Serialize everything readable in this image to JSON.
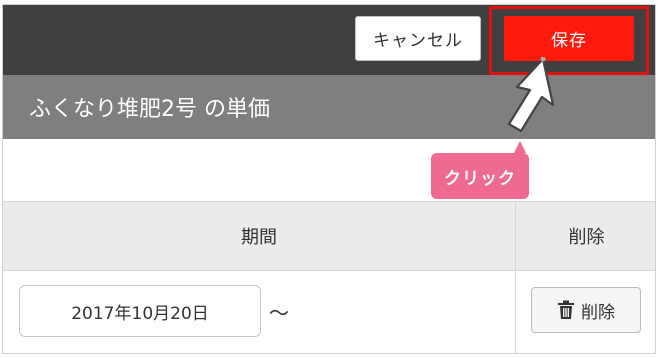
{
  "toolbar": {
    "cancel_label": "キャンセル",
    "save_label": "保存"
  },
  "header": {
    "title": "ふくなり堆肥2号 の単価"
  },
  "annotation": {
    "click_label": "クリック"
  },
  "table": {
    "headers": {
      "period": "期間",
      "delete": "削除"
    },
    "rows": [
      {
        "start_date": "2017年10月20日",
        "separator": "〜",
        "delete_label": "削除"
      }
    ]
  },
  "colors": {
    "toolbar_bg": "#404040",
    "title_bg": "#7f7f7f",
    "save_bg": "#ff1a0d",
    "highlight": "#e01010",
    "click_tag": "#ee6a8f"
  },
  "icons": {
    "trash": "trash-icon",
    "cursor": "arrow-cursor-icon"
  }
}
